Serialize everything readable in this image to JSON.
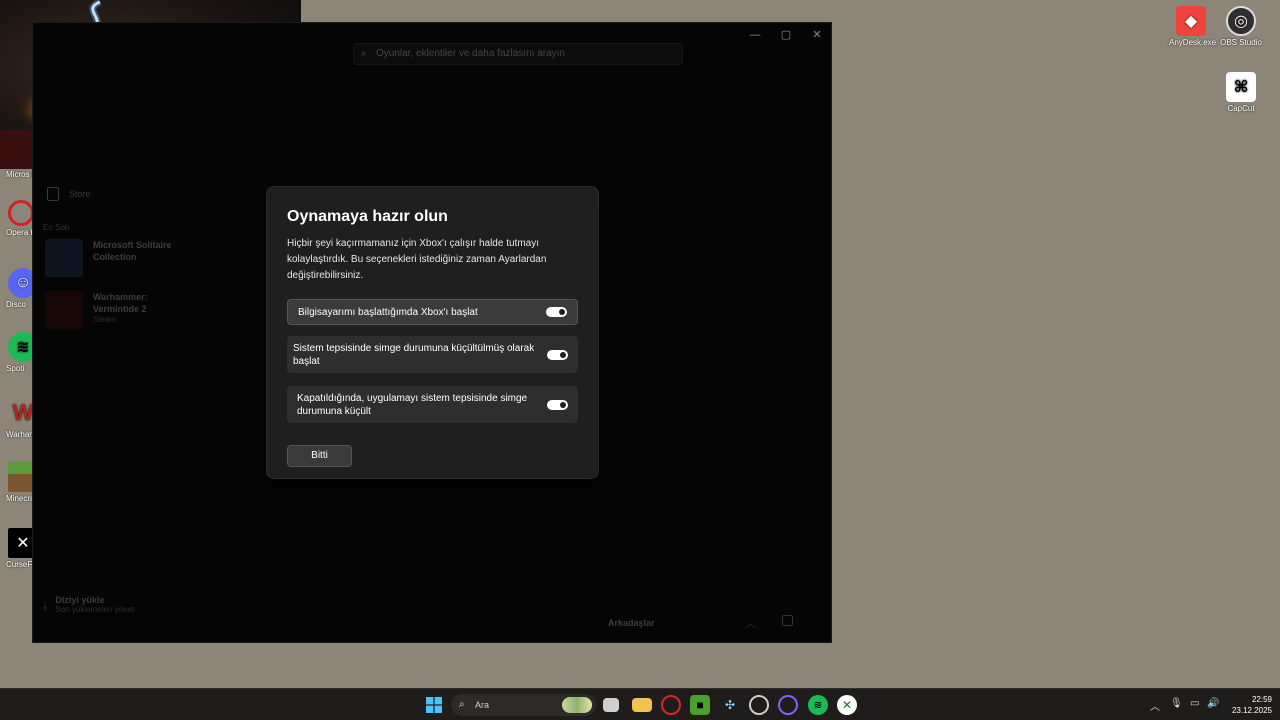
{
  "desktop": {
    "right_icons": [
      {
        "label": "AnyDesk.exe",
        "icon": "anydesk-icon",
        "color": "#ef443b"
      },
      {
        "label": "OBS Studio",
        "icon": "obs-icon",
        "color": "#302e31"
      },
      {
        "label": "CapCut",
        "icon": "capcut-icon",
        "color": "#ffffff"
      }
    ],
    "left_icons": [
      {
        "label": "Micros Edge",
        "icon": "edge-icon"
      },
      {
        "label": "Opera taray",
        "icon": "opera-icon"
      },
      {
        "label": "Disco",
        "icon": "discord-icon"
      },
      {
        "label": "Spoti",
        "icon": "spotify-icon"
      },
      {
        "label": "Warham Vermint",
        "icon": "warhammer-icon"
      },
      {
        "label": "Minecra",
        "icon": "minecraft-icon"
      },
      {
        "label": "CurseF",
        "icon": "curseforge-icon"
      }
    ]
  },
  "xbox_app": {
    "search_placeholder": "Oyunlar, eklentiler ve daha fazlasını arayın",
    "sidebar": {
      "store_label": "Store",
      "recent_label": "En Son",
      "games": [
        {
          "name": "Microsoft Solitaire Collection",
          "sub": ""
        },
        {
          "name": "Warhammer: Vermintide 2",
          "sub": "Steam"
        }
      ],
      "bulk_title": "Diziyi yükle",
      "bulk_sub": "Son yüklemeleri yönet"
    },
    "friends_label": "Arkadaşlar"
  },
  "dialog": {
    "title": "Oynamaya hazır olun",
    "description": "Hiçbir şeyi kaçırmamanız için Xbox'ı çalışır halde tutmayı kolaylaştırdık. Bu seçenekleri istediğiniz zaman Ayarlardan değiştirebilirsiniz.",
    "options": [
      {
        "label": "Bilgisayarımı başlattığımda Xbox'ı başlat",
        "on": true
      },
      {
        "label": "Sistem tepsisinde simge durumuna küçültülmüş olarak başlat",
        "on": true
      },
      {
        "label": "Kapatıldığında, uygulamayı sistem tepsisinde simge durumuna küçült",
        "on": true
      }
    ],
    "done_label": "Bitti"
  },
  "taskbar": {
    "search_label": "Ara",
    "time": "22:59",
    "date": "23.12.2025"
  }
}
